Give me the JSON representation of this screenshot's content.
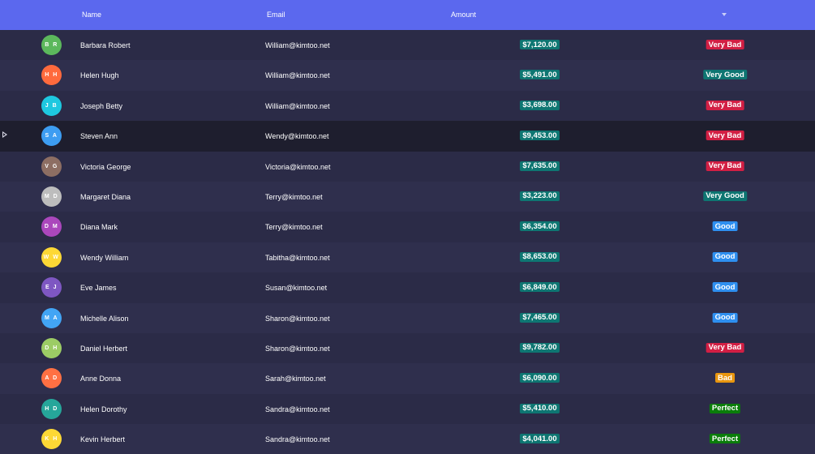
{
  "header": {
    "columns": {
      "name": "Name",
      "email": "Email",
      "amount": "Amount"
    }
  },
  "colors": {
    "header": "#5b68ee",
    "background": "#2b2b47",
    "selected_row": "#1e1e2e",
    "amount_badge": "#0e7672",
    "status": {
      "Very Bad": "#d21f44",
      "Very Good": "#0e7672",
      "Good": "#2e8ff0",
      "Bad": "#e8960f",
      "Perfect": "#0a7d0a"
    }
  },
  "rows": [
    {
      "initials": "B R",
      "avatar_color": "#5cb85c",
      "name": "Barbara Robert",
      "email": "William@kimtoo.net",
      "amount": "$7,120.00",
      "status": "Very Bad"
    },
    {
      "initials": "H H",
      "avatar_color": "#ff6a3d",
      "name": "Helen Hugh",
      "email": "William@kimtoo.net",
      "amount": "$5,491.00",
      "status": "Very Good"
    },
    {
      "initials": "J B",
      "avatar_color": "#1ec8e0",
      "name": "Joseph Betty",
      "email": "William@kimtoo.net",
      "amount": "$3,698.00",
      "status": "Very Bad"
    },
    {
      "initials": "S A",
      "avatar_color": "#3d9df2",
      "name": "Steven Ann",
      "email": "Wendy@kimtoo.net",
      "amount": "$9,453.00",
      "status": "Very Bad",
      "selected": true
    },
    {
      "initials": "V G",
      "avatar_color": "#8d6e63",
      "name": "Victoria George",
      "email": "Victoria@kimtoo.net",
      "amount": "$7,635.00",
      "status": "Very Bad"
    },
    {
      "initials": "M D",
      "avatar_color": "#bdbdbd",
      "name": "Margaret Diana",
      "email": "Terry@kimtoo.net",
      "amount": "$3,223.00",
      "status": "Very Good"
    },
    {
      "initials": "D M",
      "avatar_color": "#ab47bc",
      "name": "Diana Mark",
      "email": "Terry@kimtoo.net",
      "amount": "$6,354.00",
      "status": "Good"
    },
    {
      "initials": "W W",
      "avatar_color": "#fdd835",
      "name": "Wendy William",
      "email": "Tabitha@kimtoo.net",
      "amount": "$8,653.00",
      "status": "Good"
    },
    {
      "initials": "E J",
      "avatar_color": "#7e57c2",
      "name": "Eve James",
      "email": "Susan@kimtoo.net",
      "amount": "$6,849.00",
      "status": "Good"
    },
    {
      "initials": "M A",
      "avatar_color": "#42a5f5",
      "name": "Michelle Alison",
      "email": "Sharon@kimtoo.net",
      "amount": "$7,465.00",
      "status": "Good"
    },
    {
      "initials": "D H",
      "avatar_color": "#9ccc65",
      "name": "Daniel Herbert",
      "email": "Sharon@kimtoo.net",
      "amount": "$9,782.00",
      "status": "Very Bad"
    },
    {
      "initials": "A D",
      "avatar_color": "#ff7043",
      "name": "Anne Donna",
      "email": "Sarah@kimtoo.net",
      "amount": "$6,090.00",
      "status": "Bad"
    },
    {
      "initials": "H D",
      "avatar_color": "#26a69a",
      "name": "Helen Dorothy",
      "email": "Sandra@kimtoo.net",
      "amount": "$5,410.00",
      "status": "Perfect"
    },
    {
      "initials": "K H",
      "avatar_color": "#fdd835",
      "name": "Kevin Herbert",
      "email": "Sandra@kimtoo.net",
      "amount": "$4,041.00",
      "status": "Perfect"
    }
  ]
}
